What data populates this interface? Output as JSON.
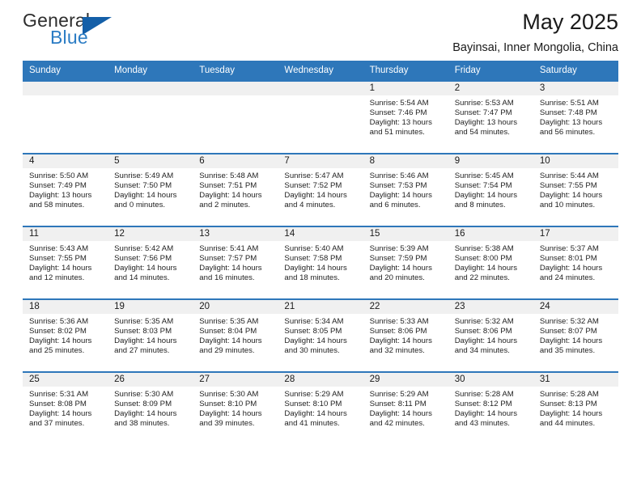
{
  "brand": {
    "name_part1": "General",
    "name_part2": "Blue",
    "flag_color": "#145fa8",
    "accent_color": "#2b7cc4"
  },
  "header": {
    "title": "May 2025",
    "subtitle": "Bayinsai, Inner Mongolia, China"
  },
  "theme": {
    "header_row_color": "#2e77ba",
    "daynum_band_color": "#f0f0f0",
    "row_border_color": "#2e77ba"
  },
  "calendar": {
    "weekday_headers": [
      "Sunday",
      "Monday",
      "Tuesday",
      "Wednesday",
      "Thursday",
      "Friday",
      "Saturday"
    ],
    "weeks": [
      [
        {
          "day": "",
          "empty": true
        },
        {
          "day": "",
          "empty": true
        },
        {
          "day": "",
          "empty": true
        },
        {
          "day": "",
          "empty": true
        },
        {
          "day": "1",
          "sunrise": "Sunrise: 5:54 AM",
          "sunset": "Sunset: 7:46 PM",
          "daylight_line1": "Daylight: 13 hours",
          "daylight_line2": "and 51 minutes."
        },
        {
          "day": "2",
          "sunrise": "Sunrise: 5:53 AM",
          "sunset": "Sunset: 7:47 PM",
          "daylight_line1": "Daylight: 13 hours",
          "daylight_line2": "and 54 minutes."
        },
        {
          "day": "3",
          "sunrise": "Sunrise: 5:51 AM",
          "sunset": "Sunset: 7:48 PM",
          "daylight_line1": "Daylight: 13 hours",
          "daylight_line2": "and 56 minutes."
        }
      ],
      [
        {
          "day": "4",
          "sunrise": "Sunrise: 5:50 AM",
          "sunset": "Sunset: 7:49 PM",
          "daylight_line1": "Daylight: 13 hours",
          "daylight_line2": "and 58 minutes."
        },
        {
          "day": "5",
          "sunrise": "Sunrise: 5:49 AM",
          "sunset": "Sunset: 7:50 PM",
          "daylight_line1": "Daylight: 14 hours",
          "daylight_line2": "and 0 minutes."
        },
        {
          "day": "6",
          "sunrise": "Sunrise: 5:48 AM",
          "sunset": "Sunset: 7:51 PM",
          "daylight_line1": "Daylight: 14 hours",
          "daylight_line2": "and 2 minutes."
        },
        {
          "day": "7",
          "sunrise": "Sunrise: 5:47 AM",
          "sunset": "Sunset: 7:52 PM",
          "daylight_line1": "Daylight: 14 hours",
          "daylight_line2": "and 4 minutes."
        },
        {
          "day": "8",
          "sunrise": "Sunrise: 5:46 AM",
          "sunset": "Sunset: 7:53 PM",
          "daylight_line1": "Daylight: 14 hours",
          "daylight_line2": "and 6 minutes."
        },
        {
          "day": "9",
          "sunrise": "Sunrise: 5:45 AM",
          "sunset": "Sunset: 7:54 PM",
          "daylight_line1": "Daylight: 14 hours",
          "daylight_line2": "and 8 minutes."
        },
        {
          "day": "10",
          "sunrise": "Sunrise: 5:44 AM",
          "sunset": "Sunset: 7:55 PM",
          "daylight_line1": "Daylight: 14 hours",
          "daylight_line2": "and 10 minutes."
        }
      ],
      [
        {
          "day": "11",
          "sunrise": "Sunrise: 5:43 AM",
          "sunset": "Sunset: 7:55 PM",
          "daylight_line1": "Daylight: 14 hours",
          "daylight_line2": "and 12 minutes."
        },
        {
          "day": "12",
          "sunrise": "Sunrise: 5:42 AM",
          "sunset": "Sunset: 7:56 PM",
          "daylight_line1": "Daylight: 14 hours",
          "daylight_line2": "and 14 minutes."
        },
        {
          "day": "13",
          "sunrise": "Sunrise: 5:41 AM",
          "sunset": "Sunset: 7:57 PM",
          "daylight_line1": "Daylight: 14 hours",
          "daylight_line2": "and 16 minutes."
        },
        {
          "day": "14",
          "sunrise": "Sunrise: 5:40 AM",
          "sunset": "Sunset: 7:58 PM",
          "daylight_line1": "Daylight: 14 hours",
          "daylight_line2": "and 18 minutes."
        },
        {
          "day": "15",
          "sunrise": "Sunrise: 5:39 AM",
          "sunset": "Sunset: 7:59 PM",
          "daylight_line1": "Daylight: 14 hours",
          "daylight_line2": "and 20 minutes."
        },
        {
          "day": "16",
          "sunrise": "Sunrise: 5:38 AM",
          "sunset": "Sunset: 8:00 PM",
          "daylight_line1": "Daylight: 14 hours",
          "daylight_line2": "and 22 minutes."
        },
        {
          "day": "17",
          "sunrise": "Sunrise: 5:37 AM",
          "sunset": "Sunset: 8:01 PM",
          "daylight_line1": "Daylight: 14 hours",
          "daylight_line2": "and 24 minutes."
        }
      ],
      [
        {
          "day": "18",
          "sunrise": "Sunrise: 5:36 AM",
          "sunset": "Sunset: 8:02 PM",
          "daylight_line1": "Daylight: 14 hours",
          "daylight_line2": "and 25 minutes."
        },
        {
          "day": "19",
          "sunrise": "Sunrise: 5:35 AM",
          "sunset": "Sunset: 8:03 PM",
          "daylight_line1": "Daylight: 14 hours",
          "daylight_line2": "and 27 minutes."
        },
        {
          "day": "20",
          "sunrise": "Sunrise: 5:35 AM",
          "sunset": "Sunset: 8:04 PM",
          "daylight_line1": "Daylight: 14 hours",
          "daylight_line2": "and 29 minutes."
        },
        {
          "day": "21",
          "sunrise": "Sunrise: 5:34 AM",
          "sunset": "Sunset: 8:05 PM",
          "daylight_line1": "Daylight: 14 hours",
          "daylight_line2": "and 30 minutes."
        },
        {
          "day": "22",
          "sunrise": "Sunrise: 5:33 AM",
          "sunset": "Sunset: 8:06 PM",
          "daylight_line1": "Daylight: 14 hours",
          "daylight_line2": "and 32 minutes."
        },
        {
          "day": "23",
          "sunrise": "Sunrise: 5:32 AM",
          "sunset": "Sunset: 8:06 PM",
          "daylight_line1": "Daylight: 14 hours",
          "daylight_line2": "and 34 minutes."
        },
        {
          "day": "24",
          "sunrise": "Sunrise: 5:32 AM",
          "sunset": "Sunset: 8:07 PM",
          "daylight_line1": "Daylight: 14 hours",
          "daylight_line2": "and 35 minutes."
        }
      ],
      [
        {
          "day": "25",
          "sunrise": "Sunrise: 5:31 AM",
          "sunset": "Sunset: 8:08 PM",
          "daylight_line1": "Daylight: 14 hours",
          "daylight_line2": "and 37 minutes."
        },
        {
          "day": "26",
          "sunrise": "Sunrise: 5:30 AM",
          "sunset": "Sunset: 8:09 PM",
          "daylight_line1": "Daylight: 14 hours",
          "daylight_line2": "and 38 minutes."
        },
        {
          "day": "27",
          "sunrise": "Sunrise: 5:30 AM",
          "sunset": "Sunset: 8:10 PM",
          "daylight_line1": "Daylight: 14 hours",
          "daylight_line2": "and 39 minutes."
        },
        {
          "day": "28",
          "sunrise": "Sunrise: 5:29 AM",
          "sunset": "Sunset: 8:10 PM",
          "daylight_line1": "Daylight: 14 hours",
          "daylight_line2": "and 41 minutes."
        },
        {
          "day": "29",
          "sunrise": "Sunrise: 5:29 AM",
          "sunset": "Sunset: 8:11 PM",
          "daylight_line1": "Daylight: 14 hours",
          "daylight_line2": "and 42 minutes."
        },
        {
          "day": "30",
          "sunrise": "Sunrise: 5:28 AM",
          "sunset": "Sunset: 8:12 PM",
          "daylight_line1": "Daylight: 14 hours",
          "daylight_line2": "and 43 minutes."
        },
        {
          "day": "31",
          "sunrise": "Sunrise: 5:28 AM",
          "sunset": "Sunset: 8:13 PM",
          "daylight_line1": "Daylight: 14 hours",
          "daylight_line2": "and 44 minutes."
        }
      ]
    ]
  }
}
